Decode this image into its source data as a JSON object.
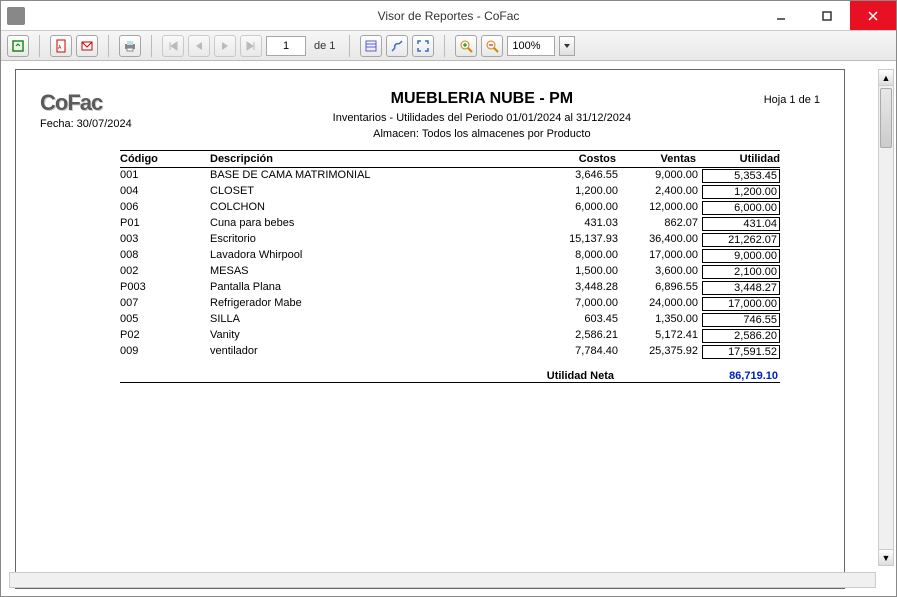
{
  "window": {
    "title": "Visor de Reportes - CoFac"
  },
  "toolbar": {
    "page_input": "1",
    "page_of_label": "de 1",
    "zoom_value": "100%"
  },
  "report": {
    "logo_text": "CoFac",
    "fecha_label": "Fecha: 30/07/2024",
    "company": "MUEBLERIA NUBE - PM",
    "subtitle": "Inventarios - Utilidades del Periodo 01/01/2024 al 31/12/2024",
    "subtitle2": "Almacen: Todos los almacenes por Producto",
    "hoja": "Hoja 1 de 1",
    "headers": {
      "codigo": "Código",
      "descripcion": "Descripción",
      "costos": "Costos",
      "ventas": "Ventas",
      "utilidad": "Utilidad"
    },
    "rows": [
      {
        "codigo": "001",
        "desc": "BASE DE CAMA MATRIMONIAL",
        "cost": "3,646.55",
        "vent": "9,000.00",
        "util": "5,353.45"
      },
      {
        "codigo": "004",
        "desc": "CLOSET",
        "cost": "1,200.00",
        "vent": "2,400.00",
        "util": "1,200.00"
      },
      {
        "codigo": "006",
        "desc": "COLCHON",
        "cost": "6,000.00",
        "vent": "12,000.00",
        "util": "6,000.00"
      },
      {
        "codigo": "P01",
        "desc": "Cuna para bebes",
        "cost": "431.03",
        "vent": "862.07",
        "util": "431.04"
      },
      {
        "codigo": "003",
        "desc": "Escritorio",
        "cost": "15,137.93",
        "vent": "36,400.00",
        "util": "21,262.07"
      },
      {
        "codigo": "008",
        "desc": "Lavadora Whirpool",
        "cost": "8,000.00",
        "vent": "17,000.00",
        "util": "9,000.00"
      },
      {
        "codigo": "002",
        "desc": "MESAS",
        "cost": "1,500.00",
        "vent": "3,600.00",
        "util": "2,100.00"
      },
      {
        "codigo": "P003",
        "desc": "Pantalla Plana",
        "cost": "3,448.28",
        "vent": "6,896.55",
        "util": "3,448.27"
      },
      {
        "codigo": "007",
        "desc": "Refrigerador Mabe",
        "cost": "7,000.00",
        "vent": "24,000.00",
        "util": "17,000.00"
      },
      {
        "codigo": "005",
        "desc": "SILLA",
        "cost": "603.45",
        "vent": "1,350.00",
        "util": "746.55"
      },
      {
        "codigo": "P02",
        "desc": "Vanity",
        "cost": "2,586.21",
        "vent": "5,172.41",
        "util": "2,586.20"
      },
      {
        "codigo": "009",
        "desc": "ventilador",
        "cost": "7,784.40",
        "vent": "25,375.92",
        "util": "17,591.52"
      }
    ],
    "net_label": "Utilidad Neta",
    "net_value": "86,719.10"
  }
}
